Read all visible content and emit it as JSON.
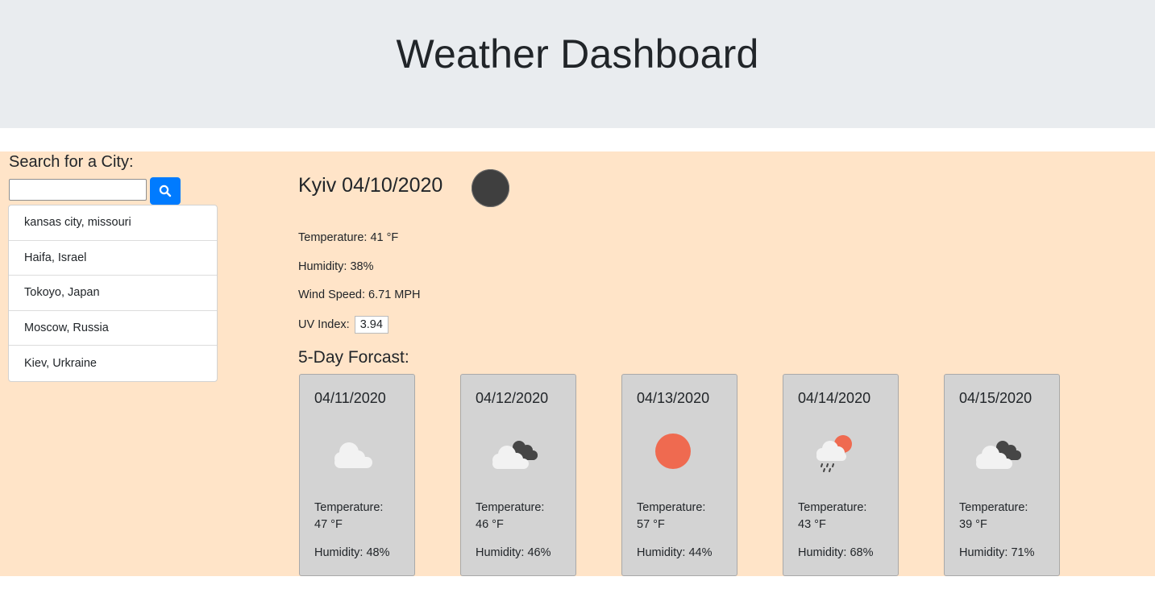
{
  "header": {
    "title": "Weather Dashboard"
  },
  "search": {
    "label": "Search for a City:",
    "value": "",
    "placeholder": "",
    "button_icon": "search-icon"
  },
  "history": [
    "kansas city, missouri",
    "Haifa, Israel",
    "Tokoyo, Japan",
    "Moscow, Russia",
    "Kiev, Urkraine"
  ],
  "current": {
    "title": "Kyiv 04/10/2020",
    "icon": "moon-night-icon",
    "temperature": "Temperature: 41 °F",
    "humidity": "Humidity: 38%",
    "wind": "Wind Speed: 6.71 MPH",
    "uv_label": "UV Index:",
    "uv_value": "3.94"
  },
  "forecast_title": "5-Day Forcast:",
  "forecast": [
    {
      "date": "04/11/2020",
      "icon": "cloud-icon",
      "temp_label": "Temperature:",
      "temp": "47 °F",
      "humidity": "Humidity: 48%"
    },
    {
      "date": "04/12/2020",
      "icon": "broken-clouds-icon",
      "temp_label": "Temperature:",
      "temp": "46 °F",
      "humidity": "Humidity: 46%"
    },
    {
      "date": "04/13/2020",
      "icon": "sun-icon",
      "temp_label": "Temperature:",
      "temp": "57 °F",
      "humidity": "Humidity: 44%"
    },
    {
      "date": "04/14/2020",
      "icon": "sun-rain-cloud-icon",
      "temp_label": "Temperature:",
      "temp": "43 °F",
      "humidity": "Humidity: 68%"
    },
    {
      "date": "04/15/2020",
      "icon": "broken-clouds-icon",
      "temp_label": "Temperature:",
      "temp": "39 °F",
      "humidity": "Humidity: 71%"
    }
  ],
  "colors": {
    "header_bg": "#e9ecef",
    "main_bg": "#ffe4c8",
    "button": "#007bff",
    "card_bg": "#d3d3d3",
    "sun": "#ef6a50"
  }
}
